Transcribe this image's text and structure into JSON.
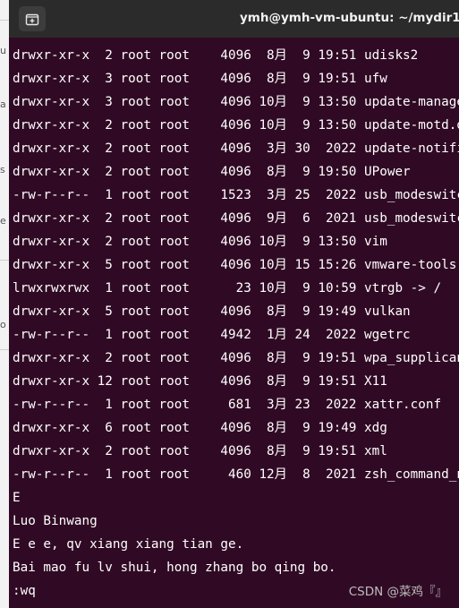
{
  "background_window": {
    "glyphs": [
      "u",
      "a",
      "s",
      "e",
      "o"
    ]
  },
  "terminal": {
    "title": "ymh@ymh-vm-ubuntu: ~/mydir1",
    "new_tab_icon": "new-tab-icon",
    "colors": {
      "background": "#300a24",
      "titlebar": "#2b2b2b",
      "text": "#ffffff"
    },
    "listing": [
      {
        "perms": "drwxr-xr-x",
        "links": "2",
        "owner": "root",
        "group": "root",
        "size": "4096",
        "month": "8月",
        "day": "9",
        "time": "19:51",
        "name": "udisks2"
      },
      {
        "perms": "drwxr-xr-x",
        "links": "3",
        "owner": "root",
        "group": "root",
        "size": "4096",
        "month": "8月",
        "day": "9",
        "time": "19:51",
        "name": "ufw"
      },
      {
        "perms": "drwxr-xr-x",
        "links": "3",
        "owner": "root",
        "group": "root",
        "size": "4096",
        "month": "10月",
        "day": "9",
        "time": "13:50",
        "name": "update-manager"
      },
      {
        "perms": "drwxr-xr-x",
        "links": "2",
        "owner": "root",
        "group": "root",
        "size": "4096",
        "month": "10月",
        "day": "9",
        "time": "13:50",
        "name": "update-motd.d"
      },
      {
        "perms": "drwxr-xr-x",
        "links": "2",
        "owner": "root",
        "group": "root",
        "size": "4096",
        "month": "3月",
        "day": "30",
        "time": "2022",
        "name": "update-notifier"
      },
      {
        "perms": "drwxr-xr-x",
        "links": "2",
        "owner": "root",
        "group": "root",
        "size": "4096",
        "month": "8月",
        "day": "9",
        "time": "19:50",
        "name": "UPower"
      },
      {
        "perms": "-rw-r--r--",
        "links": "1",
        "owner": "root",
        "group": "root",
        "size": "1523",
        "month": "3月",
        "day": "25",
        "time": "2022",
        "name": "usb_modeswitch.conf"
      },
      {
        "perms": "drwxr-xr-x",
        "links": "2",
        "owner": "root",
        "group": "root",
        "size": "4096",
        "month": "9月",
        "day": "6",
        "time": "2021",
        "name": "usb_modeswitch.d"
      },
      {
        "perms": "drwxr-xr-x",
        "links": "2",
        "owner": "root",
        "group": "root",
        "size": "4096",
        "month": "10月",
        "day": "9",
        "time": "13:50",
        "name": "vim"
      },
      {
        "perms": "drwxr-xr-x",
        "links": "5",
        "owner": "root",
        "group": "root",
        "size": "4096",
        "month": "10月",
        "day": "15",
        "time": "15:26",
        "name": "vmware-tools"
      },
      {
        "perms": "lrwxrwxrwx",
        "links": "1",
        "owner": "root",
        "group": "root",
        "size": "23",
        "month": "10月",
        "day": "9",
        "time": "10:59",
        "name": "vtrgb -> /"
      },
      {
        "perms": "drwxr-xr-x",
        "links": "5",
        "owner": "root",
        "group": "root",
        "size": "4096",
        "month": "8月",
        "day": "9",
        "time": "19:49",
        "name": "vulkan"
      },
      {
        "perms": "-rw-r--r--",
        "links": "1",
        "owner": "root",
        "group": "root",
        "size": "4942",
        "month": "1月",
        "day": "24",
        "time": "2022",
        "name": "wgetrc"
      },
      {
        "perms": "drwxr-xr-x",
        "links": "2",
        "owner": "root",
        "group": "root",
        "size": "4096",
        "month": "8月",
        "day": "9",
        "time": "19:51",
        "name": "wpa_supplicant"
      },
      {
        "perms": "drwxr-xr-x",
        "links": "12",
        "owner": "root",
        "group": "root",
        "size": "4096",
        "month": "8月",
        "day": "9",
        "time": "19:51",
        "name": "X11"
      },
      {
        "perms": "-rw-r--r--",
        "links": "1",
        "owner": "root",
        "group": "root",
        "size": "681",
        "month": "3月",
        "day": "23",
        "time": "2022",
        "name": "xattr.conf"
      },
      {
        "perms": "drwxr-xr-x",
        "links": "6",
        "owner": "root",
        "group": "root",
        "size": "4096",
        "month": "8月",
        "day": "9",
        "time": "19:49",
        "name": "xdg"
      },
      {
        "perms": "drwxr-xr-x",
        "links": "2",
        "owner": "root",
        "group": "root",
        "size": "4096",
        "month": "8月",
        "day": "9",
        "time": "19:51",
        "name": "xml"
      },
      {
        "perms": "-rw-r--r--",
        "links": "1",
        "owner": "root",
        "group": "root",
        "size": "460",
        "month": "12月",
        "day": "8",
        "time": "2021",
        "name": "zsh_command_not_found"
      }
    ],
    "text_lines": [
      "E",
      "Luo Binwang",
      "E e e, qv xiang xiang tian ge.",
      "Bai mao fu lv shui, hong zhang bo qing bo.",
      ":wq"
    ],
    "watermark": "CSDN @菜鸡『』"
  }
}
